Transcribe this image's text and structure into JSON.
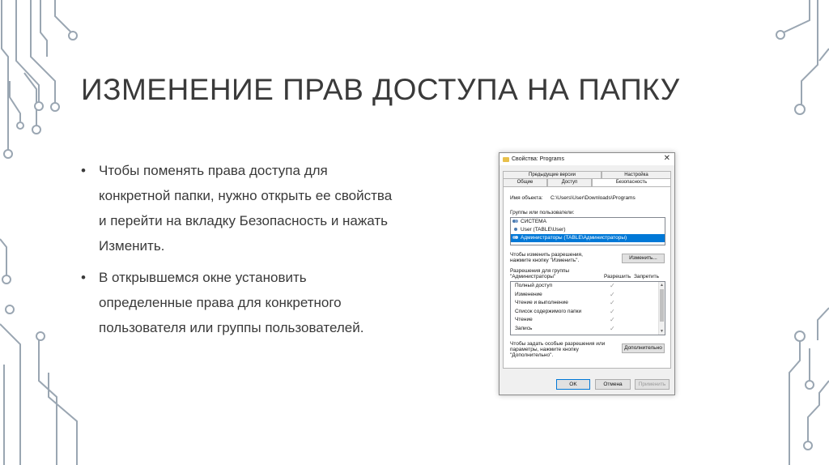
{
  "slide": {
    "title": "ИЗМЕНЕНИЕ ПРАВ ДОСТУПА НА ПАПКУ",
    "bullets": [
      "Чтобы поменять права доступа для конкретной папки, нужно открыть ее свойства и перейти на вкладку Безопасность и нажать Изменить.",
      "В открывшемся окне установить определенные права для конкретного пользователя или группы пользователей."
    ]
  },
  "colors": {
    "decor": "#9aa6b2",
    "accent_blue": "#0078d7",
    "folder": "#e8c04a"
  },
  "dialog": {
    "title": "Свойства: Programs",
    "tabs_back": [
      "Предыдущие версии",
      "Настройка"
    ],
    "tabs_front": [
      "Общие",
      "Доступ",
      "Безопасность"
    ],
    "object_label": "Имя объекта:",
    "object_path": "C:\\Users\\User\\Downloads\\Programs",
    "groups_label": "Группы или пользователи:",
    "groups": [
      "СИСТЕМА",
      "User (TABLE\\User)",
      "Администраторы (TABLE\\Администраторы)"
    ],
    "change_hint_1": "Чтобы изменить разрешения,",
    "change_hint_2": "нажмите кнопку \"Изменить\".",
    "change_button": "Изменить...",
    "perm_for_1": "Разрешения для группы",
    "perm_for_2": "\"Администраторы\"",
    "col_allow": "Разрешить",
    "col_deny": "Запретить",
    "permissions": [
      "Полный доступ",
      "Изменение",
      "Чтение и выполнение",
      "Список содержимого папки",
      "Чтение",
      "Запись"
    ],
    "special_hint_1": "Чтобы задать особые разрешения или",
    "special_hint_2": "параметры, нажмите кнопку",
    "special_hint_3": "\"Дополнительно\".",
    "advanced_button": "Дополнительно",
    "ok": "OK",
    "cancel": "Отмена",
    "apply": "Применить"
  }
}
